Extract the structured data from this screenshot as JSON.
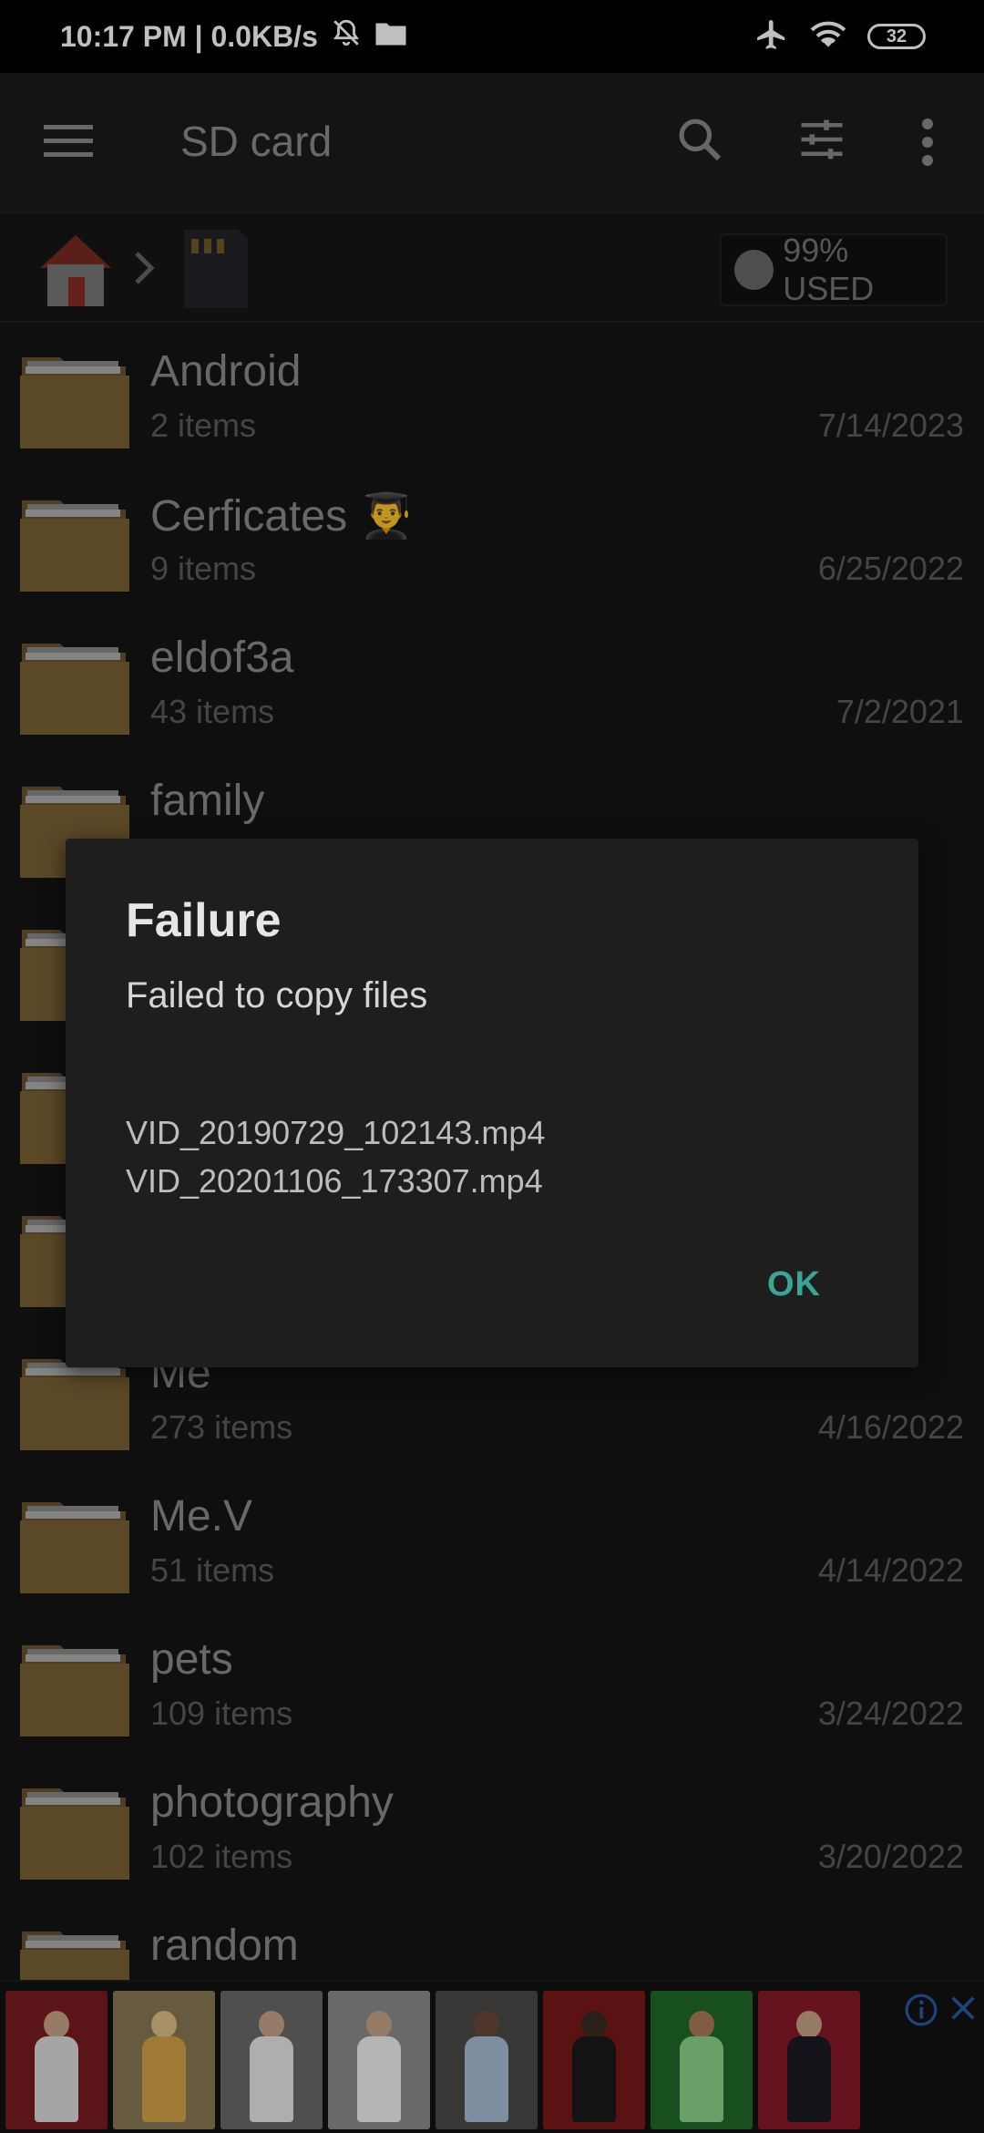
{
  "status_bar": {
    "time": "10:17 PM | 0.0KB/s",
    "battery": "32"
  },
  "toolbar": {
    "title": "SD card"
  },
  "pathbar": {
    "usage": "99% USED"
  },
  "files": [
    {
      "name": "Android",
      "count": "2 items",
      "date": "7/14/2023"
    },
    {
      "name": "Cerficates 👨‍🎓",
      "count": "9 items",
      "date": "6/25/2022"
    },
    {
      "name": "eldof3a",
      "count": "43 items",
      "date": "7/2/2021"
    },
    {
      "name": "family",
      "count": "",
      "date": ""
    },
    {
      "name": "",
      "count": "",
      "date": ""
    },
    {
      "name": "",
      "count": "",
      "date": ""
    },
    {
      "name": "",
      "count": "",
      "date": ""
    },
    {
      "name": "Me",
      "count": "273 items",
      "date": "4/16/2022"
    },
    {
      "name": "Me.V",
      "count": "51 items",
      "date": "4/14/2022"
    },
    {
      "name": "pets",
      "count": "109 items",
      "date": "3/24/2022"
    },
    {
      "name": "photography",
      "count": "102 items",
      "date": "3/20/2022"
    },
    {
      "name": "random",
      "count": "",
      "date": ""
    }
  ],
  "dialog": {
    "title": "Failure",
    "message": "Failed to copy files",
    "files": [
      "VID_20190729_102143.mp4",
      "VID_20201106_173307.mp4"
    ],
    "ok_label": "OK"
  },
  "colors": {
    "accent": "#3aa593",
    "folder": "#7a6034",
    "statusbar": "#000000"
  }
}
